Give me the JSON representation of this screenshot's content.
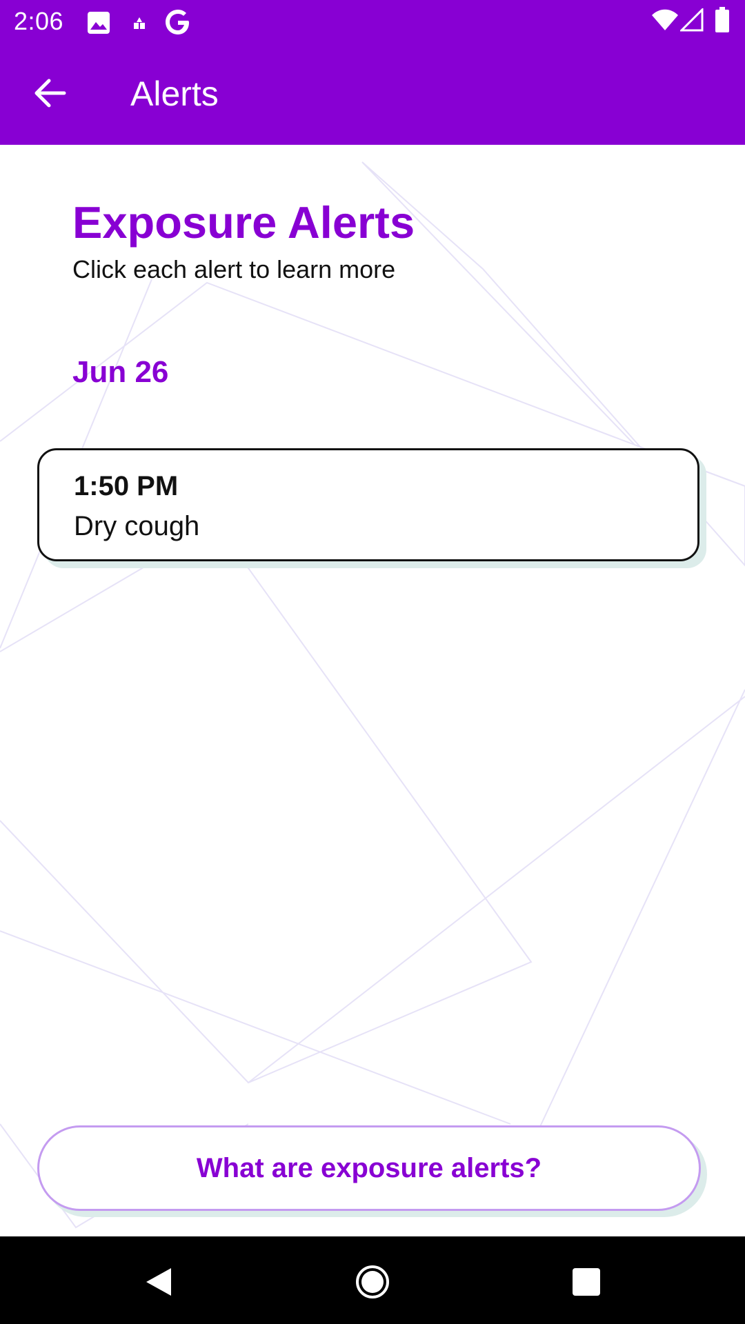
{
  "status_bar": {
    "time": "2:06",
    "icons": [
      "image-icon",
      "notification-icon",
      "google-icon",
      "wifi-icon",
      "signal-icon",
      "battery-icon"
    ]
  },
  "app_bar": {
    "title": "Alerts",
    "back_icon": "arrow-left-icon"
  },
  "main": {
    "heading": "Exposure Alerts",
    "subheading": "Click each alert to learn more",
    "groups": [
      {
        "date": "Jun 26",
        "alerts": [
          {
            "time": "1:50 PM",
            "symptom": "Dry cough"
          }
        ]
      }
    ],
    "info_button_label": "What are exposure alerts?"
  },
  "nav_bar": {
    "icons": [
      "back-triangle-icon",
      "home-circle-icon",
      "recents-square-icon"
    ]
  },
  "colors": {
    "accent": "#8800d3",
    "card_shadow": "#dcecea",
    "button_border": "#c49bf0"
  }
}
